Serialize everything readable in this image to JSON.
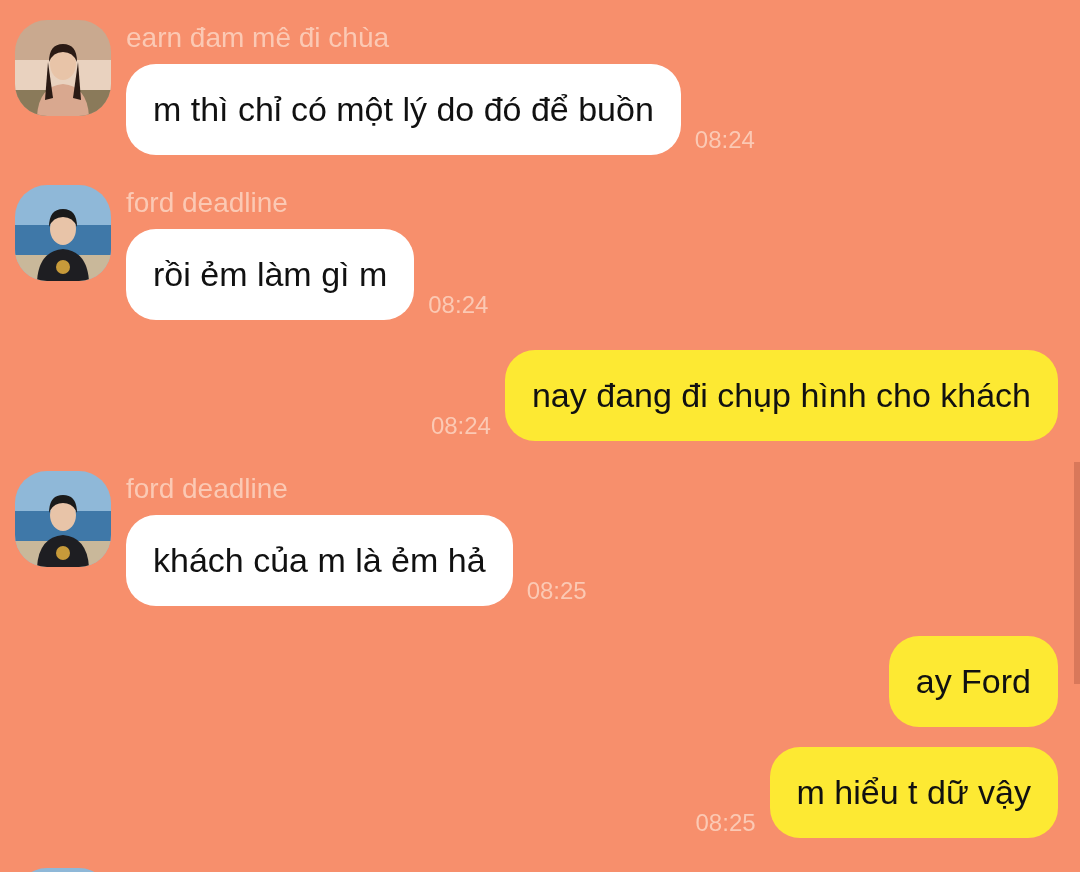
{
  "messages": [
    {
      "kind": "incoming",
      "sender": "earn đam mê đi chùa",
      "text": "m thì chỉ có một lý do đó để buồn",
      "time": "08:24"
    },
    {
      "kind": "incoming",
      "sender": "ford deadline",
      "text": "rồi ẻm làm gì m",
      "time": "08:24"
    },
    {
      "kind": "outgoing",
      "text": "nay đang đi chụp hình cho khách",
      "time": "08:24"
    },
    {
      "kind": "incoming",
      "sender": "ford deadline",
      "text": "khách của m là ẻm hả",
      "time": "08:25"
    },
    {
      "kind": "outgoing",
      "text": "ay Ford"
    },
    {
      "kind": "outgoing",
      "text": "m hiểu t dữ vậy",
      "time": "08:25"
    }
  ]
}
